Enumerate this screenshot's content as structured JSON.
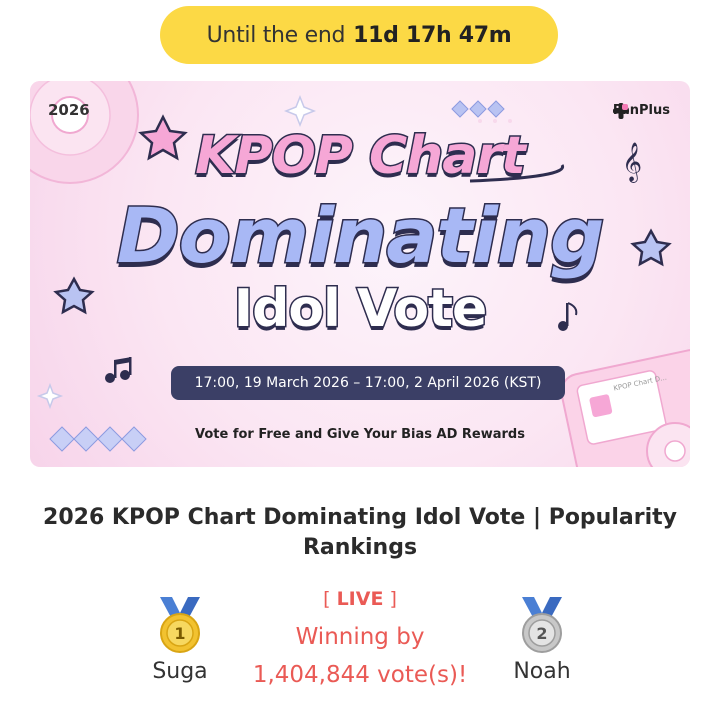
{
  "countdown": {
    "prefix": "Until the end",
    "time": "11d 17h 47m"
  },
  "banner": {
    "year": "2026",
    "brand": "FanPlus",
    "title_line1": "KPOP Chart",
    "title_line2": "Dominating",
    "title_line3": "Idol Vote",
    "dates": "17:00, 19 March 2026 – 17:00, 2 April 2026 (KST)",
    "tagline": "Vote for Free and Give Your Bias AD Rewards",
    "phone_caption": "KPOP Chart D..."
  },
  "page_title": "2026 KPOP Chart Dominating Idol  Vote | Popularity Rankings",
  "rankings": {
    "first": {
      "position": "1",
      "name": "Suga"
    },
    "second": {
      "position": "2",
      "name": "Noah"
    }
  },
  "live": {
    "open": "[ ",
    "label": "LIVE",
    "close": " ]",
    "winning_prefix": "Winning by",
    "margin": "1,404,844 vote(s)!"
  },
  "colors": {
    "countdown_bg": "#fcd945",
    "live_red": "#ea5a55",
    "banner_pink": "#f7d4ea",
    "date_pill": "#3b3f66",
    "gold": "#f2c230",
    "silver": "#c8c8c8",
    "ribbon_blue": "#4a7fd4"
  }
}
